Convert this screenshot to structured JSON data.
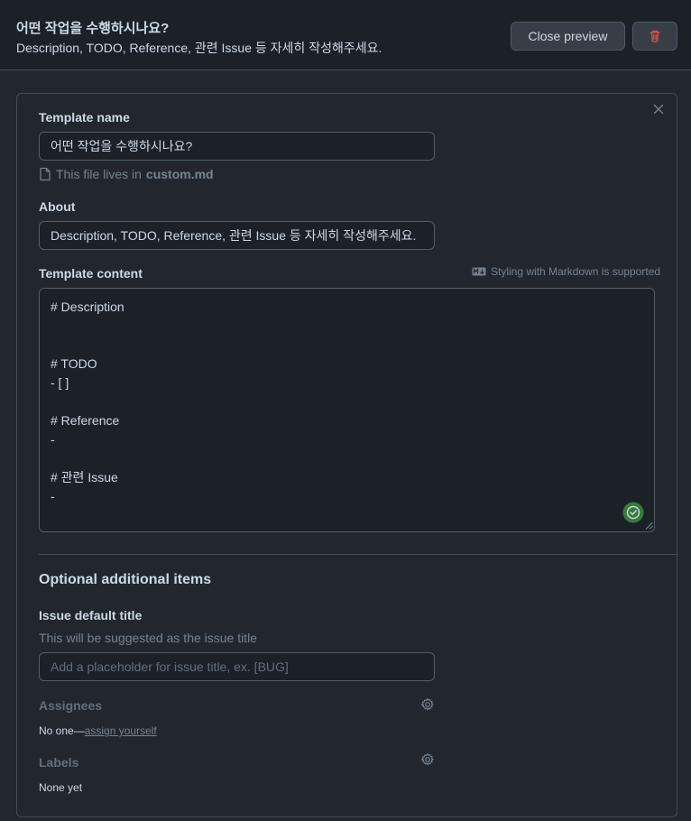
{
  "header": {
    "title": "어떤 작업을 수행하시나요?",
    "subtitle": "Description, TODO, Reference, 관련 Issue 등 자세히 작성해주세요.",
    "close_preview_label": "Close preview",
    "delete_icon": "trash-icon"
  },
  "form": {
    "template_name_label": "Template name",
    "template_name_value": "어떤 작업을 수행하시나요?",
    "file_note_prefix": "This file lives in",
    "file_name": "custom.md",
    "about_label": "About",
    "about_value": "Description, TODO, Reference, 관련 Issue 등 자세히 작성해주세요.",
    "content_label": "Template content",
    "markdown_hint": "Styling with Markdown is supported",
    "content_value": "# Description\n\n\n# TODO\n- [ ]\n\n# Reference\n-\n\n# 관련 Issue\n-"
  },
  "optional": {
    "section_title": "Optional additional items",
    "issue_title_label": "Issue default title",
    "issue_title_hint": "This will be suggested as the issue title",
    "issue_title_placeholder": "Add a placeholder for issue title, ex. [BUG]",
    "assignees_label": "Assignees",
    "assignees_none": "No one—",
    "assign_yourself": "assign yourself",
    "labels_label": "Labels",
    "labels_none": "None yet"
  },
  "colors": {
    "background": "#22272e",
    "danger": "#e5534b",
    "success": "#347d39"
  }
}
